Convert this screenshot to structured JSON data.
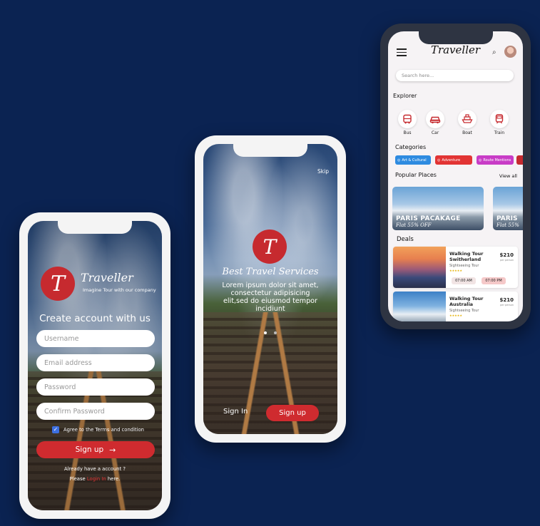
{
  "colors": {
    "background": "#0b2352",
    "accent": "#cf2b2f"
  },
  "signup": {
    "brand": "Traveller",
    "tagline": "Imagine Tour with our company",
    "title": "Create account with us",
    "fields": {
      "username": "Username",
      "email": "Email address",
      "password": "Password",
      "confirm": "Confirm Password"
    },
    "agree": "Agree to the Terms and condition",
    "signup_label": "Sign up",
    "already": "Already have a account ?",
    "please": "Please",
    "login_link": "Login In",
    "here": "here."
  },
  "onboarding": {
    "skip": "Skip",
    "logo_letter": "T",
    "headline": "Best Travel Services",
    "body": "Lorem ipsum dolor sit amet, consectetur adipisicing elit,sed do eiusmod tempor incidiunt",
    "signin_label": "Sign In",
    "signup_label": "Sign up"
  },
  "home": {
    "brand": "Traveller",
    "search_placeholder": "Search here...",
    "explorer_title": "Explorer",
    "modes": [
      {
        "label": "Bus",
        "icon": "bus-icon"
      },
      {
        "label": "Car",
        "icon": "car-icon"
      },
      {
        "label": "Boat",
        "icon": "boat-icon"
      },
      {
        "label": "Train",
        "icon": "train-icon"
      }
    ],
    "categories_title": "Categories",
    "categories": [
      {
        "label": "Art & Cultural",
        "color": "#2e8be0"
      },
      {
        "label": "Adventure",
        "color": "#e23434"
      },
      {
        "label": "Route Mentions",
        "color": "#c83cc6"
      }
    ],
    "popular_title": "Popular Places",
    "view_all": "View all",
    "places": [
      {
        "title": "PARIS PACAKAGE",
        "offer": "Flat 55% OFF"
      },
      {
        "title": "PARIS",
        "offer": "Flat 55%"
      }
    ],
    "deals_title": "Deals",
    "deals": [
      {
        "title": "Walking Tour",
        "subtitle": "Switherland",
        "type": "Sightseeing Tour",
        "price": "$210",
        "per": "per person",
        "times": [
          "07:00 AM",
          "07:00 PM"
        ]
      },
      {
        "title": "Walking Tour",
        "subtitle": "Australia",
        "type": "Sightseeing Tour",
        "price": "$210",
        "per": "per person",
        "times": []
      }
    ]
  }
}
